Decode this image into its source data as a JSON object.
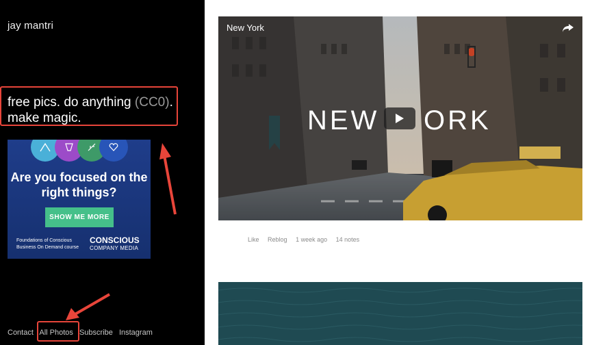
{
  "sidebar": {
    "site_title": "jay mantri",
    "tagline_line1_a": "free pics. do anything ",
    "tagline_cc": "(CC0)",
    "tagline_line1_b": ".",
    "tagline_line2": "make magic.",
    "ad": {
      "headline": "Are you focused on the right things?",
      "cta_label": "SHOW ME MORE",
      "subtext": "Foundations of Conscious Business On Demand course",
      "brand_name": "CONSCIOUS",
      "brand_sub": "COMPANY MEDIA"
    },
    "footer_links": [
      "Contact",
      "All Photos",
      "Subscribe",
      "Instagram"
    ]
  },
  "posts": [
    {
      "video_title": "New York",
      "overlay_left": "NEW",
      "overlay_right": "ORK",
      "meta": {
        "like": "Like",
        "reblog": "Reblog",
        "time": "1 week ago",
        "notes": "14 notes"
      }
    }
  ],
  "colors": {
    "annotation": "#e8453a",
    "ad_bg": "#1f3d8a",
    "ad_cta": "#45c08a",
    "post2_bg": "#1f4a52"
  }
}
